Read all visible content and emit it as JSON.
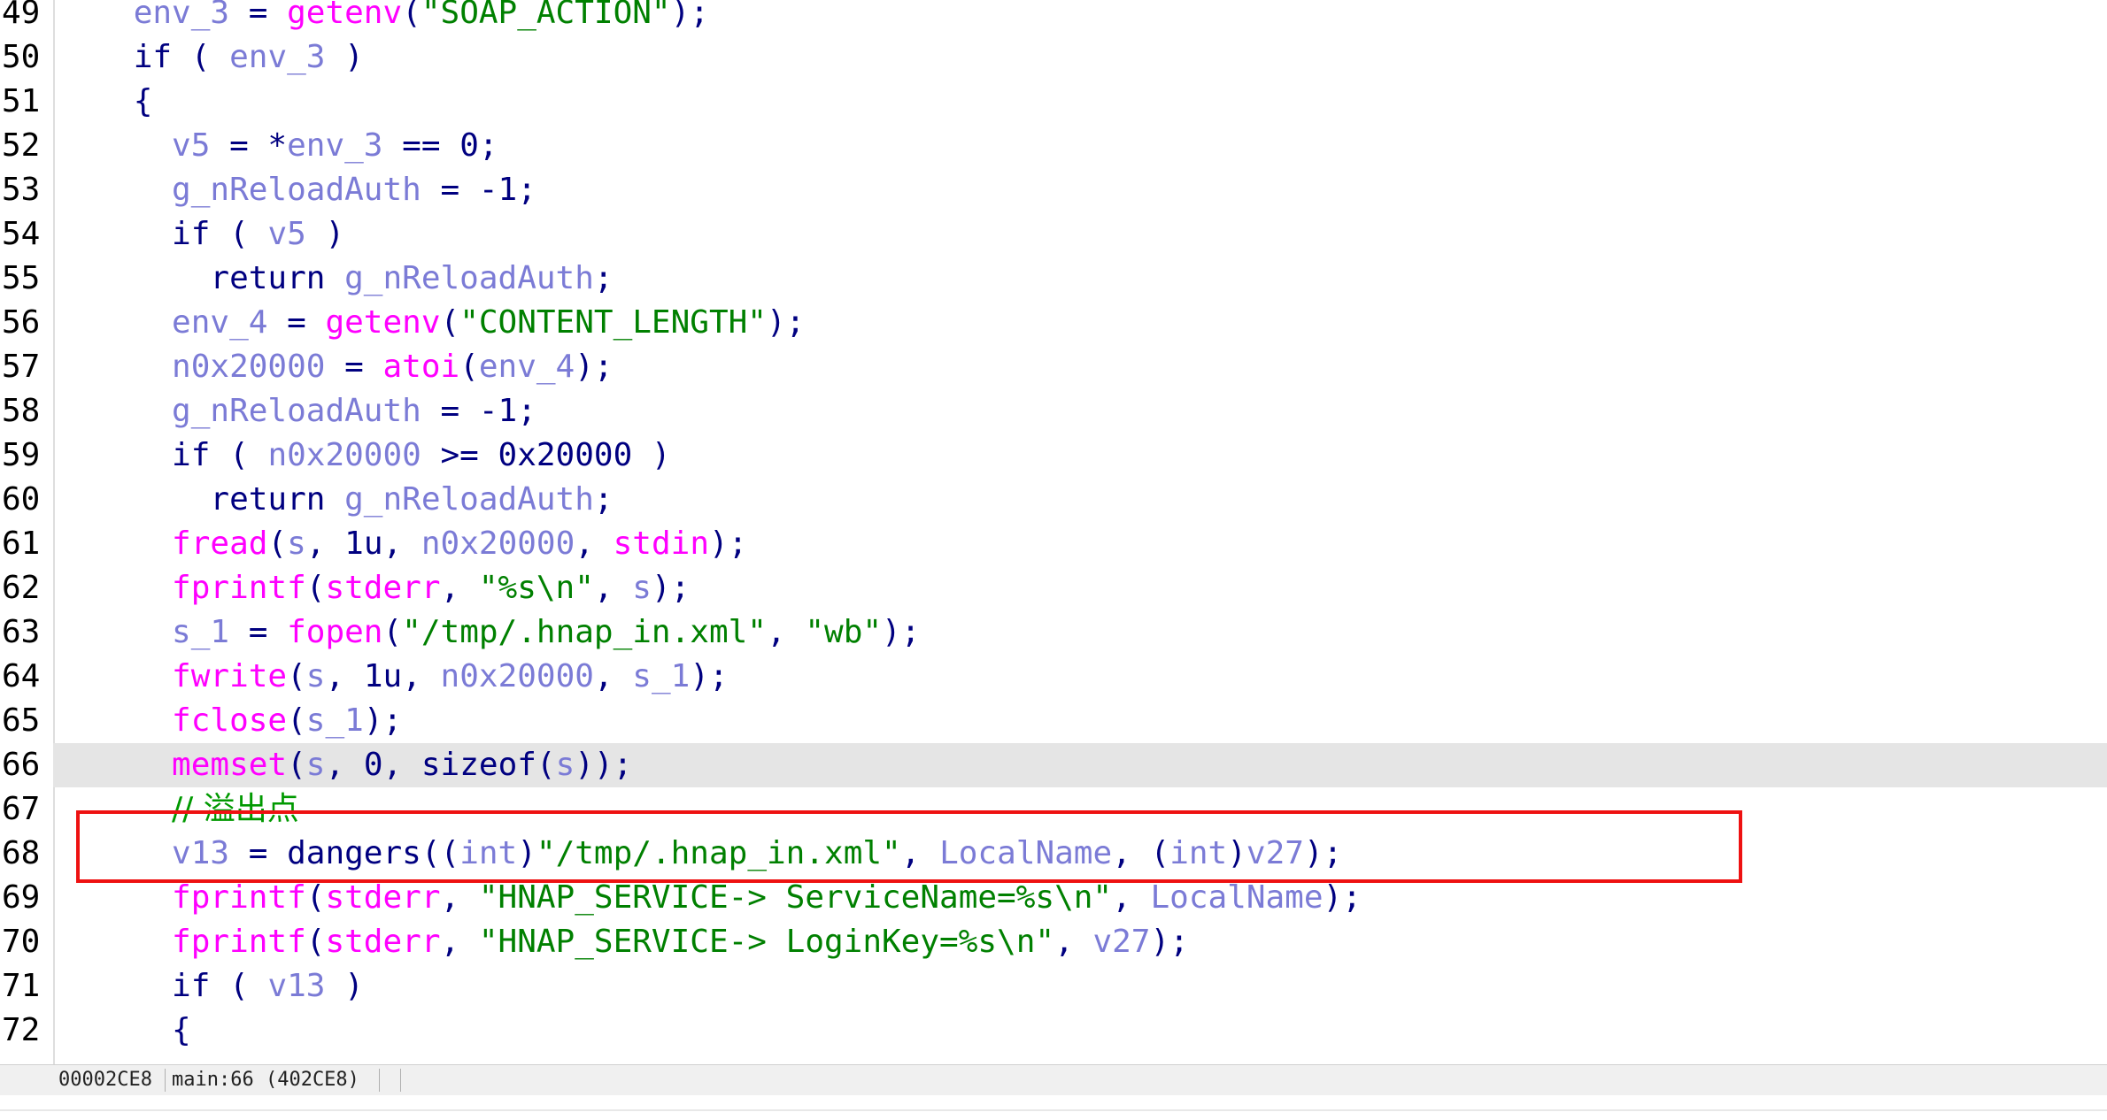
{
  "editor": {
    "lines": [
      {
        "n": "49",
        "tokens": [
          [
            "    ",
            "op"
          ],
          [
            "env_3",
            "var"
          ],
          [
            " = ",
            "op"
          ],
          [
            "getenv",
            "fn"
          ],
          [
            "(",
            "op"
          ],
          [
            "\"SOAP_ACTION\"",
            "str"
          ],
          [
            ");",
            "op"
          ]
        ]
      },
      {
        "n": "50",
        "tokens": [
          [
            "    ",
            "op"
          ],
          [
            "if",
            "kw"
          ],
          [
            " ( ",
            "op"
          ],
          [
            "env_3",
            "var"
          ],
          [
            " )",
            "op"
          ]
        ]
      },
      {
        "n": "51",
        "tokens": [
          [
            "    {",
            "op"
          ]
        ]
      },
      {
        "n": "52",
        "tokens": [
          [
            "      ",
            "op"
          ],
          [
            "v5",
            "var"
          ],
          [
            " = *",
            "op"
          ],
          [
            "env_3",
            "var"
          ],
          [
            " == ",
            "op"
          ],
          [
            "0",
            "num"
          ],
          [
            ";",
            "op"
          ]
        ]
      },
      {
        "n": "53",
        "tokens": [
          [
            "      ",
            "op"
          ],
          [
            "g_nReloadAuth",
            "var"
          ],
          [
            " = -",
            "op"
          ],
          [
            "1",
            "num"
          ],
          [
            ";",
            "op"
          ]
        ]
      },
      {
        "n": "54",
        "tokens": [
          [
            "      ",
            "op"
          ],
          [
            "if",
            "kw"
          ],
          [
            " ( ",
            "op"
          ],
          [
            "v5",
            "var"
          ],
          [
            " )",
            "op"
          ]
        ]
      },
      {
        "n": "55",
        "tokens": [
          [
            "        ",
            "op"
          ],
          [
            "return",
            "kw"
          ],
          [
            " ",
            "op"
          ],
          [
            "g_nReloadAuth",
            "var"
          ],
          [
            ";",
            "op"
          ]
        ]
      },
      {
        "n": "56",
        "tokens": [
          [
            "      ",
            "op"
          ],
          [
            "env_4",
            "var"
          ],
          [
            " = ",
            "op"
          ],
          [
            "getenv",
            "fn"
          ],
          [
            "(",
            "op"
          ],
          [
            "\"CONTENT_LENGTH\"",
            "str"
          ],
          [
            ");",
            "op"
          ]
        ]
      },
      {
        "n": "57",
        "tokens": [
          [
            "      ",
            "op"
          ],
          [
            "n0x20000",
            "var"
          ],
          [
            " = ",
            "op"
          ],
          [
            "atoi",
            "fn"
          ],
          [
            "(",
            "op"
          ],
          [
            "env_4",
            "var"
          ],
          [
            ");",
            "op"
          ]
        ]
      },
      {
        "n": "58",
        "tokens": [
          [
            "      ",
            "op"
          ],
          [
            "g_nReloadAuth",
            "var"
          ],
          [
            " = -",
            "op"
          ],
          [
            "1",
            "num"
          ],
          [
            ";",
            "op"
          ]
        ]
      },
      {
        "n": "59",
        "tokens": [
          [
            "      ",
            "op"
          ],
          [
            "if",
            "kw"
          ],
          [
            " ( ",
            "op"
          ],
          [
            "n0x20000",
            "var"
          ],
          [
            " >= ",
            "op"
          ],
          [
            "0x20000",
            "num"
          ],
          [
            " )",
            "op"
          ]
        ]
      },
      {
        "n": "60",
        "tokens": [
          [
            "        ",
            "op"
          ],
          [
            "return",
            "kw"
          ],
          [
            " ",
            "op"
          ],
          [
            "g_nReloadAuth",
            "var"
          ],
          [
            ";",
            "op"
          ]
        ]
      },
      {
        "n": "61",
        "tokens": [
          [
            "      ",
            "op"
          ],
          [
            "fread",
            "fn"
          ],
          [
            "(",
            "op"
          ],
          [
            "s",
            "var"
          ],
          [
            ", ",
            "op"
          ],
          [
            "1u",
            "num"
          ],
          [
            ", ",
            "op"
          ],
          [
            "n0x20000",
            "var"
          ],
          [
            ", ",
            "op"
          ],
          [
            "stdin",
            "fn"
          ],
          [
            ");",
            "op"
          ]
        ]
      },
      {
        "n": "62",
        "tokens": [
          [
            "      ",
            "op"
          ],
          [
            "fprintf",
            "fn"
          ],
          [
            "(",
            "op"
          ],
          [
            "stderr",
            "fn"
          ],
          [
            ", ",
            "op"
          ],
          [
            "\"%s\\n\"",
            "str"
          ],
          [
            ", ",
            "op"
          ],
          [
            "s",
            "var"
          ],
          [
            ");",
            "op"
          ]
        ]
      },
      {
        "n": "63",
        "tokens": [
          [
            "      ",
            "op"
          ],
          [
            "s_1",
            "var"
          ],
          [
            " = ",
            "op"
          ],
          [
            "fopen",
            "fn"
          ],
          [
            "(",
            "op"
          ],
          [
            "\"/tmp/.hnap_in.xml\"",
            "str"
          ],
          [
            ", ",
            "op"
          ],
          [
            "\"wb\"",
            "str"
          ],
          [
            ");",
            "op"
          ]
        ]
      },
      {
        "n": "64",
        "tokens": [
          [
            "      ",
            "op"
          ],
          [
            "fwrite",
            "fn"
          ],
          [
            "(",
            "op"
          ],
          [
            "s",
            "var"
          ],
          [
            ", ",
            "op"
          ],
          [
            "1u",
            "num"
          ],
          [
            ", ",
            "op"
          ],
          [
            "n0x20000",
            "var"
          ],
          [
            ", ",
            "op"
          ],
          [
            "s_1",
            "var"
          ],
          [
            ");",
            "op"
          ]
        ]
      },
      {
        "n": "65",
        "tokens": [
          [
            "      ",
            "op"
          ],
          [
            "fclose",
            "fn"
          ],
          [
            "(",
            "op"
          ],
          [
            "s_1",
            "var"
          ],
          [
            ");",
            "op"
          ]
        ]
      },
      {
        "n": "66",
        "current": true,
        "tokens": [
          [
            "      ",
            "op"
          ],
          [
            "memset",
            "fn"
          ],
          [
            "(",
            "op"
          ],
          [
            "s",
            "var"
          ],
          [
            ", ",
            "op"
          ],
          [
            "0",
            "num"
          ],
          [
            ", ",
            "op"
          ],
          [
            "sizeof",
            "call"
          ],
          [
            "(",
            "op"
          ],
          [
            "s",
            "var"
          ],
          [
            "));",
            "op"
          ]
        ]
      },
      {
        "n": "67",
        "tokens": [
          [
            "      ",
            "op"
          ],
          [
            "// 溢出点",
            "cmt"
          ]
        ]
      },
      {
        "n": "68",
        "tokens": [
          [
            "      ",
            "op"
          ],
          [
            "v13",
            "var"
          ],
          [
            " = ",
            "op"
          ],
          [
            "dangers",
            "call"
          ],
          [
            "((",
            "op"
          ],
          [
            "int",
            "var"
          ],
          [
            ")",
            "op"
          ],
          [
            "\"/tmp/.hnap_in.xml\"",
            "str"
          ],
          [
            ", ",
            "op"
          ],
          [
            "LocalName",
            "var"
          ],
          [
            ", (",
            "op"
          ],
          [
            "int",
            "var"
          ],
          [
            ")",
            "op"
          ],
          [
            "v27",
            "var"
          ],
          [
            ");",
            "op"
          ]
        ]
      },
      {
        "n": "69",
        "tokens": [
          [
            "      ",
            "op"
          ],
          [
            "fprintf",
            "fn"
          ],
          [
            "(",
            "op"
          ],
          [
            "stderr",
            "fn"
          ],
          [
            ", ",
            "op"
          ],
          [
            "\"HNAP_SERVICE-> ServiceName=%s\\n\"",
            "str"
          ],
          [
            ", ",
            "op"
          ],
          [
            "LocalName",
            "var"
          ],
          [
            ");",
            "op"
          ]
        ]
      },
      {
        "n": "70",
        "tokens": [
          [
            "      ",
            "op"
          ],
          [
            "fprintf",
            "fn"
          ],
          [
            "(",
            "op"
          ],
          [
            "stderr",
            "fn"
          ],
          [
            ", ",
            "op"
          ],
          [
            "\"HNAP_SERVICE-> LoginKey=%s\\n\"",
            "str"
          ],
          [
            ", ",
            "op"
          ],
          [
            "v27",
            "var"
          ],
          [
            ");",
            "op"
          ]
        ]
      },
      {
        "n": "71",
        "tokens": [
          [
            "      ",
            "op"
          ],
          [
            "if",
            "kw"
          ],
          [
            " ( ",
            "op"
          ],
          [
            "v13",
            "var"
          ],
          [
            " )",
            "op"
          ]
        ]
      },
      {
        "n": "72",
        "tokens": [
          [
            "      {",
            "op"
          ]
        ]
      }
    ]
  },
  "status_bar": {
    "address": "00002CE8",
    "location": "main:66 (402CE8)"
  },
  "colors": {
    "keyword": "#000080",
    "variable": "#7b7bd6",
    "function": "#ff00ff",
    "string": "#008000",
    "highlight_box": "#ee1111",
    "current_line": "#e5e5e5"
  }
}
